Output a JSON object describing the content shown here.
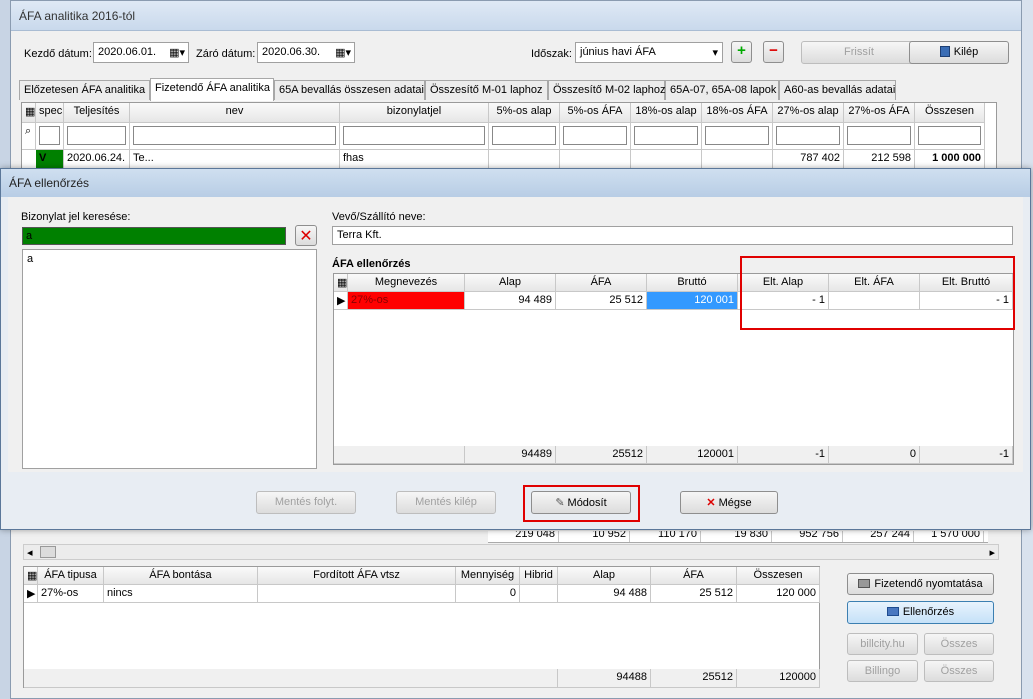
{
  "main_window": {
    "title": "ÁFA analitika 2016-tól",
    "start_label": "Kezdő dátum:",
    "start_value": "2020.06.01.",
    "end_label": "Záró dátum:",
    "end_value": "2020.06.30.",
    "period_label": "Időszak:",
    "period_value": "június havi ÁFA",
    "refresh_label": "Frissít",
    "exit_label": "Kilép"
  },
  "tabs": [
    "Előzetesen ÁFA analitika",
    "Fizetendő ÁFA analitika",
    "65A bevallás összesen adatai",
    "Összesítő M-01 laphoz",
    "Összesítő M-02 laphoz",
    "65A-07, 65A-08 lapok",
    "A60-as bevallás adatai"
  ],
  "top_grid": {
    "columns": [
      "spec",
      "Teljesítés",
      "nev",
      "bizonylatjel",
      "5%-os alap",
      "5%-os ÁFA",
      "18%-os alap",
      "18%-os ÁFA",
      "27%-os alap",
      "27%-os ÁFA",
      "Összesen"
    ],
    "row": [
      "V",
      "2020.06.24.",
      "Te...",
      "fhas",
      "",
      "",
      "",
      "",
      "787 402",
      "212 598",
      "1 000 000"
    ],
    "totals": [
      "219 048",
      "10 952",
      "110 170",
      "19 830",
      "952 756",
      "257 244",
      "1 570 000"
    ]
  },
  "bottom_grid": {
    "columns": [
      "ÁFA tipusa",
      "ÁFA bontása",
      "Fordított ÁFA vtsz",
      "Mennyiség",
      "Hibrid",
      "Alap",
      "ÁFA",
      "Összesen"
    ],
    "row": [
      "27%-os",
      "nincs",
      "",
      "0",
      "",
      "94 488",
      "25 512",
      "120 000"
    ],
    "totals": [
      "94488",
      "25512",
      "120000"
    ]
  },
  "side_buttons": {
    "print": "Fizetendő nyomtatása",
    "check": "Ellenőrzés",
    "billcity": "billcity.hu",
    "osszes1": "Összes",
    "billingo": "Billingo",
    "osszes2": "Összes"
  },
  "dialog": {
    "title": "ÁFA ellenőrzés",
    "search_label": "Bizonylat jel keresése:",
    "search_value": "a",
    "list_items": [
      "a"
    ],
    "partner_label": "Vevő/Szállító neve:",
    "partner_value": "Terra Kft.",
    "section_title": "ÁFA ellenőrzés",
    "columns": [
      "Megnevezés",
      "Alap",
      "ÁFA",
      "Bruttó",
      "Elt. Alap",
      "Elt. ÁFA",
      "Elt. Bruttó"
    ],
    "row": [
      "27%-os",
      "94 489",
      "25 512",
      "120 001",
      "- 1",
      "",
      "- 1"
    ],
    "totals": [
      "94489",
      "25512",
      "120001",
      "-1",
      "0",
      "-1"
    ],
    "buttons": {
      "save_cont": "Mentés folyt.",
      "save_exit": "Mentés kilép",
      "modify": "Módosít",
      "cancel": "Mégse"
    }
  },
  "colors": {
    "green": "#008000",
    "red": "#ff0000",
    "blue_sel": "#3399ff",
    "highlight": "#e00000"
  }
}
